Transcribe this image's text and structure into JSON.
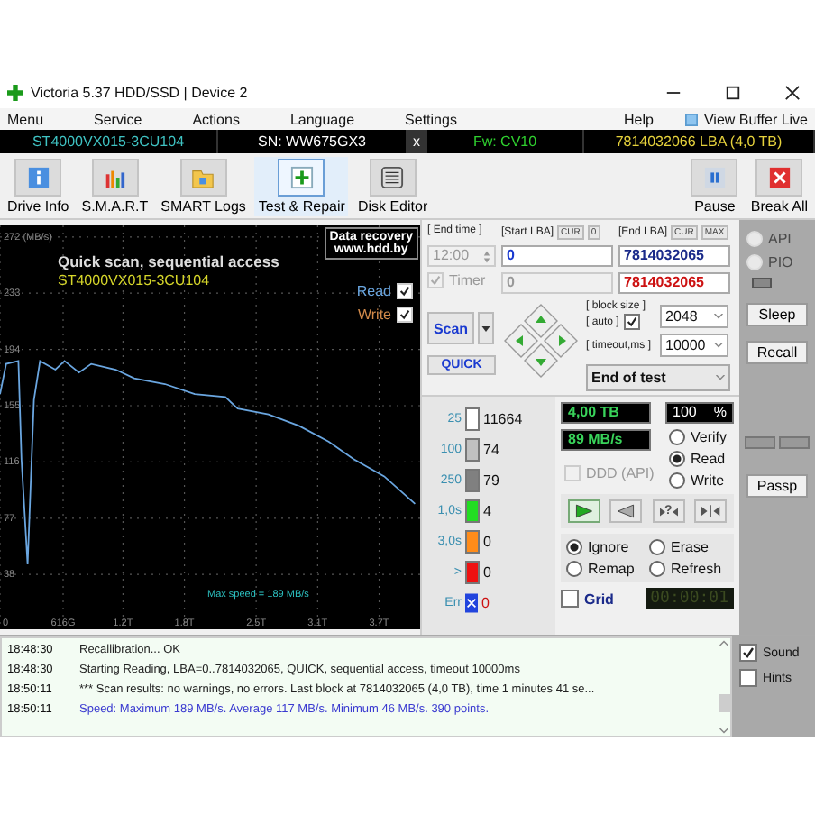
{
  "window": {
    "title": "Victoria 5.37 HDD/SSD | Device 2"
  },
  "menu": {
    "items": [
      "Menu",
      "Service",
      "Actions",
      "Language",
      "Settings"
    ],
    "help": "Help",
    "buffer_link": "View Buffer Live"
  },
  "device_bar": {
    "model": "ST4000VX015-3CU104",
    "serial": "SN: WW675GX3",
    "close": "x",
    "firmware": "Fw: CV10",
    "capacity": "7814032066 LBA (4,0 TB)"
  },
  "toolbar": {
    "items": [
      {
        "label": "Drive Info",
        "kind": "info",
        "selected": false
      },
      {
        "label": "S.M.A.R.T",
        "kind": "smart",
        "selected": false
      },
      {
        "label": "SMART Logs",
        "kind": "logs",
        "selected": false
      },
      {
        "label": "Test & Repair",
        "kind": "test",
        "selected": true
      },
      {
        "label": "Disk Editor",
        "kind": "editor",
        "selected": false
      }
    ],
    "right_items": [
      {
        "label": "Pause",
        "kind": "pause"
      },
      {
        "label": "Break All",
        "kind": "break"
      }
    ]
  },
  "graph": {
    "title": "Quick scan, sequential access",
    "model": "ST4000VX015-3CU104",
    "badge": [
      "Data recovery",
      "www.hdd.by"
    ],
    "read": {
      "checked": true
    },
    "write": {
      "label": "Write",
      "checked": true
    },
    "max_speed": "Max speed = 189 MB/s",
    "x_label_gb": "616G",
    "chart_data": {
      "type": "line",
      "grid": true,
      "xlim": [
        0,
        4.1
      ],
      "ylim": [
        0,
        280
      ],
      "x": [
        0,
        0.06,
        0.18,
        0.21,
        0.27,
        0.33,
        0.39,
        0.54,
        0.63,
        0.77,
        0.89,
        1.13,
        1.31,
        1.61,
        1.9,
        2.2,
        2.32,
        2.62,
        2.92,
        3.21,
        3.45,
        3.75,
        4.05
      ],
      "xticks": [
        {
          "value": 0,
          "label": "0"
        },
        {
          "value": 1.2,
          "label": "1.2T"
        },
        {
          "value": 1.8,
          "label": "1.8T"
        },
        {
          "value": 2.5,
          "label": "2.5T"
        },
        {
          "value": 3.1,
          "label": "3.1T"
        },
        {
          "value": 3.7,
          "label": "3.7T"
        }
      ],
      "series": [
        {
          "name": "Read",
          "color": "#6aa6e0",
          "values": [
            163,
            184,
            186,
            118,
            45,
            159,
            186,
            180,
            186,
            178,
            184,
            180,
            174,
            170,
            163,
            161,
            153,
            149,
            141,
            130,
            118,
            106,
            87
          ]
        }
      ],
      "yticks": [
        {
          "value": 272,
          "label": "272 (MB/s)"
        },
        233,
        194,
        155,
        116,
        77,
        38
      ]
    }
  },
  "settings": {
    "end_time_label": "[ End time ]",
    "end_time": "12:00",
    "timer": {
      "label": "Timer",
      "checked": true,
      "disabled": true
    },
    "start_lba": {
      "label": "[Start LBA]",
      "cur": "CUR",
      "cur_value": "0",
      "value": "0",
      "current": "0"
    },
    "end_lba": {
      "label": "[End LBA]",
      "cur": "CUR",
      "max": "MAX",
      "value": "7814032065",
      "current": "7814032065"
    },
    "scan": "Scan",
    "quick": "QUICK",
    "block_size_label": "[ block size ]",
    "auto": {
      "label": "[ auto ]",
      "checked": true
    },
    "block_size": "2048",
    "timeout_label": "[ timeout,ms ]",
    "timeout": "10000",
    "end_action": "End of test"
  },
  "stats": [
    {
      "label": "25",
      "color": "#ffffff",
      "count": "11664",
      "kind": "block"
    },
    {
      "label": "100",
      "color": "#c0c0c0",
      "count": "74",
      "kind": "block"
    },
    {
      "label": "250",
      "color": "#808080",
      "count": "79",
      "kind": "block"
    },
    {
      "label": "1,0s",
      "color": "#22dd22",
      "count": "4",
      "kind": "block"
    },
    {
      "label": "3,0s",
      "color": "#ff8c1a",
      "count": "0",
      "kind": "block"
    },
    {
      "label": ">",
      "color": "#ee1111",
      "count": "0",
      "kind": "block"
    },
    {
      "label": "Err",
      "color": "#2244dd",
      "count": "0",
      "kind": "error"
    }
  ],
  "status": {
    "capacity": "4,00 TB",
    "percent": "100",
    "percent_unit": "%",
    "speed": "89 MB/s",
    "ddd": {
      "label": "DDD (API)",
      "checked": false,
      "disabled": true
    }
  },
  "mode": [
    {
      "label": "Verify",
      "selected": false
    },
    {
      "label": "Read",
      "selected": true
    },
    {
      "label": "Write",
      "selected": false
    }
  ],
  "transport": [
    {
      "kind": "forward",
      "selected": true
    },
    {
      "kind": "backward",
      "selected": false
    },
    {
      "kind": "random",
      "selected": false,
      "glyph": "?"
    },
    {
      "kind": "butterfly",
      "selected": false
    }
  ],
  "repair": [
    {
      "label": "Ignore",
      "selected": true
    },
    {
      "label": "Erase",
      "selected": false
    },
    {
      "label": "Remap",
      "selected": false
    },
    {
      "label": "Refresh",
      "selected": false
    }
  ],
  "grid": {
    "label": "Grid",
    "checked": false
  },
  "elapsed": "00:00:01",
  "side": {
    "api": {
      "label": "API",
      "selected": false
    },
    "pio": {
      "label": "PIO",
      "selected": false
    },
    "sleep": "Sleep",
    "recall": "Recall",
    "passp": "Passp"
  },
  "log": [
    {
      "time": "18:48:30",
      "text": "Recallibration... OK",
      "kind": "normal"
    },
    {
      "time": "18:48:30",
      "text": "Starting Reading, LBA=0..7814032065, QUICK, sequential access, timeout 10000ms",
      "kind": "normal"
    },
    {
      "time": "18:50:11",
      "text": "*** Scan results: no warnings, no errors. Last block at 7814032065 (4,0 TB), time 1 minutes 41 se...",
      "kind": "normal"
    },
    {
      "time": "18:50:11",
      "text": "Speed: Maximum 189 MB/s. Average 117 MB/s. Minimum 46 MB/s. 390 points.",
      "kind": "summary"
    }
  ],
  "log_options": [
    {
      "label": "Sound",
      "checked": true
    },
    {
      "label": "Hints",
      "checked": false
    }
  ]
}
